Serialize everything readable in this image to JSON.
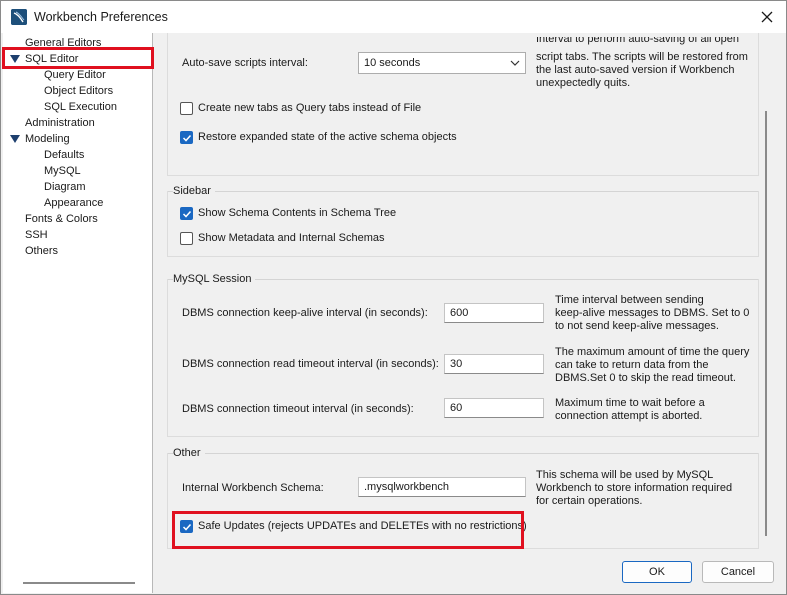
{
  "window": {
    "title": "Workbench Preferences",
    "icon": "mysql-workbench-icon",
    "close_icon": "close-icon"
  },
  "sidebar": {
    "items": [
      {
        "label": "General Editors",
        "level": 0,
        "expandable": false
      },
      {
        "label": "SQL Editor",
        "level": 0,
        "expandable": true,
        "expanded": true,
        "selected": true
      },
      {
        "label": "Query Editor",
        "level": 1
      },
      {
        "label": "Object Editors",
        "level": 1
      },
      {
        "label": "SQL Execution",
        "level": 1
      },
      {
        "label": "Administration",
        "level": 0,
        "expandable": false
      },
      {
        "label": "Modeling",
        "level": 0,
        "expandable": true,
        "expanded": true
      },
      {
        "label": "Defaults",
        "level": 1
      },
      {
        "label": "MySQL",
        "level": 1
      },
      {
        "label": "Diagram",
        "level": 1
      },
      {
        "label": "Appearance",
        "level": 1
      },
      {
        "label": "Fonts & Colors",
        "level": 0
      },
      {
        "label": "SSH",
        "level": 0
      },
      {
        "label": "Others",
        "level": 0
      }
    ]
  },
  "general": {
    "autosave_label": "Auto-save scripts interval:",
    "autosave_value": "10 seconds",
    "autosave_desc_line0": "Interval to perform auto-saving of all open",
    "autosave_desc_line1": "script tabs. The scripts will be restored from",
    "autosave_desc_line2": "the last auto-saved version if Workbench",
    "autosave_desc_line3": "unexpectedly quits.",
    "new_tabs_label": "Create new tabs as Query tabs instead of File",
    "new_tabs_checked": false,
    "restore_label": "Restore expanded state of the active schema objects",
    "restore_checked": true
  },
  "sidebar_group": {
    "title": "Sidebar",
    "schema_contents_label": "Show Schema Contents in Schema Tree",
    "schema_contents_checked": true,
    "metadata_label": "Show Metadata and Internal Schemas",
    "metadata_checked": false
  },
  "session_group": {
    "title": "MySQL Session",
    "keepalive_label": "DBMS connection keep-alive interval (in seconds):",
    "keepalive_value": "600",
    "keepalive_desc_line1": "Time interval between sending",
    "keepalive_desc_line2": "keep-alive messages to DBMS. Set to 0",
    "keepalive_desc_line3": "to not send keep-alive messages.",
    "read_timeout_label": "DBMS connection read timeout interval (in seconds):",
    "read_timeout_value": "30",
    "read_timeout_desc_line1": "The maximum amount of time the query",
    "read_timeout_desc_line2": "can take to return data from the",
    "read_timeout_desc_line3": "DBMS.Set 0 to skip the read timeout.",
    "conn_timeout_label": "DBMS connection timeout interval (in seconds):",
    "conn_timeout_value": "60",
    "conn_timeout_desc_line1": "Maximum time to wait before a",
    "conn_timeout_desc_line2": "connection attempt is aborted."
  },
  "other_group": {
    "title": "Other",
    "schema_label": "Internal Workbench Schema:",
    "schema_value": ".mysqlworkbench",
    "schema_desc_line1": "This schema will be used by MySQL",
    "schema_desc_line2": "Workbench to store information required",
    "schema_desc_line3": "for certain operations.",
    "safe_updates_label": "Safe Updates (rejects UPDATEs and DELETEs with no restrictions)",
    "safe_updates_checked": true
  },
  "buttons": {
    "ok": "OK",
    "cancel": "Cancel"
  },
  "colors": {
    "accent": "#1a68c2",
    "highlight_box": "#e0101f"
  }
}
